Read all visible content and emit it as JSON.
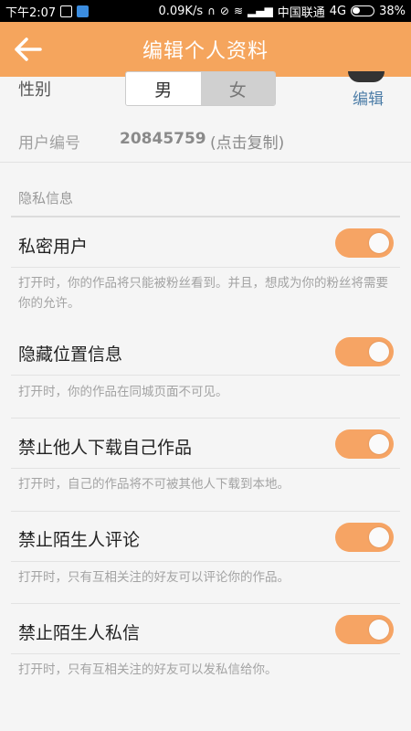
{
  "status_bar": {
    "time": "下午2:07",
    "speed": "0.09K/s",
    "carrier": "中国联通",
    "network": "4G",
    "battery": "38%"
  },
  "header": {
    "title": "编辑个人资料"
  },
  "gender": {
    "label": "性别",
    "options": [
      "男",
      "女"
    ],
    "selected": "男"
  },
  "avatar": {
    "edit_label": "编辑"
  },
  "user_id": {
    "label": "用户编号",
    "value": "20845759",
    "hint": "(点击复制)"
  },
  "privacy": {
    "section_title": "隐私信息",
    "items": [
      {
        "title": "私密用户",
        "enabled": true,
        "description": "打开时，你的作品将只能被粉丝看到。并且，想成为你的粉丝将需要你的允许。"
      },
      {
        "title": "隐藏位置信息",
        "enabled": true,
        "description": "打开时，你的作品在同城页面不可见。"
      },
      {
        "title": "禁止他人下载自己作品",
        "enabled": true,
        "description": "打开时，自己的作品将不可被其他人下载到本地。"
      },
      {
        "title": "禁止陌生人评论",
        "enabled": true,
        "description": "打开时，只有互相关注的好友可以评论你的作品。"
      },
      {
        "title": "禁止陌生人私信",
        "enabled": true,
        "description": "打开时，只有互相关注的好友可以发私信给你。"
      }
    ]
  },
  "colors": {
    "accent": "#f5a55d",
    "toggle_on": "#f6a464",
    "link": "#4e7ea8"
  }
}
